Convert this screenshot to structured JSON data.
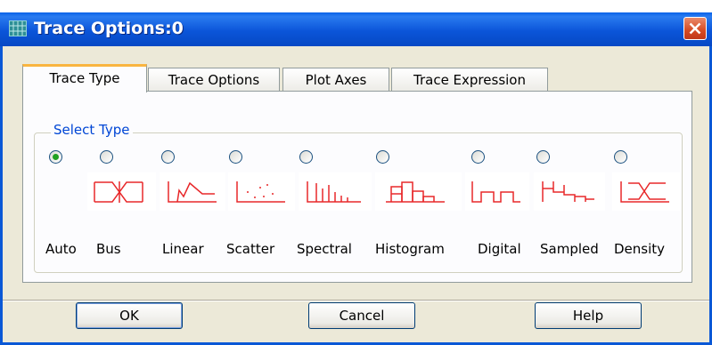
{
  "window": {
    "title": "Trace Options:0",
    "close_label": "close"
  },
  "tabs": [
    {
      "label": "Trace Type",
      "active": true
    },
    {
      "label": "Trace Options",
      "active": false
    },
    {
      "label": "Plot Axes",
      "active": false
    },
    {
      "label": "Trace Expression",
      "active": false
    }
  ],
  "group": {
    "title": "Select Type"
  },
  "trace_types": [
    {
      "label": "Auto",
      "selected": true,
      "icon": "none"
    },
    {
      "label": "Bus",
      "selected": false,
      "icon": "bus-trace-icon"
    },
    {
      "label": "Linear",
      "selected": false,
      "icon": "linear-trace-icon"
    },
    {
      "label": "Scatter",
      "selected": false,
      "icon": "scatter-trace-icon"
    },
    {
      "label": "Spectral",
      "selected": false,
      "icon": "spectral-trace-icon"
    },
    {
      "label": "Histogram",
      "selected": false,
      "icon": "histogram-trace-icon"
    },
    {
      "label": "Digital",
      "selected": false,
      "icon": "digital-trace-icon"
    },
    {
      "label": "Sampled",
      "selected": false,
      "icon": "sampled-trace-icon"
    },
    {
      "label": "Density",
      "selected": false,
      "icon": "density-trace-icon"
    }
  ],
  "buttons": {
    "ok": "OK",
    "cancel": "Cancel",
    "help": "Help"
  },
  "colors": {
    "titlebar": "#0b55d9",
    "icon_stroke": "#e8282a",
    "group_title": "#0046d5",
    "radio_selected": "#21a121"
  }
}
